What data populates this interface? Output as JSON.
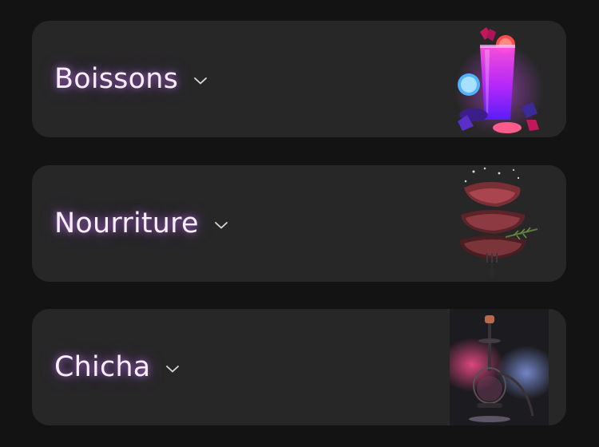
{
  "menu": {
    "categories": [
      {
        "label": "Boissons",
        "icon": "chevron-down-icon",
        "image": "cocktail-drink-image"
      },
      {
        "label": "Nourriture",
        "icon": "chevron-down-icon",
        "image": "grilled-steak-image"
      },
      {
        "label": "Chicha",
        "icon": "chevron-down-icon",
        "image": "hookah-smoke-image"
      }
    ]
  },
  "colors": {
    "background": "#131313",
    "card": "#272727",
    "title_glow": "#cd78ff",
    "title_text": "#f7eefa"
  }
}
